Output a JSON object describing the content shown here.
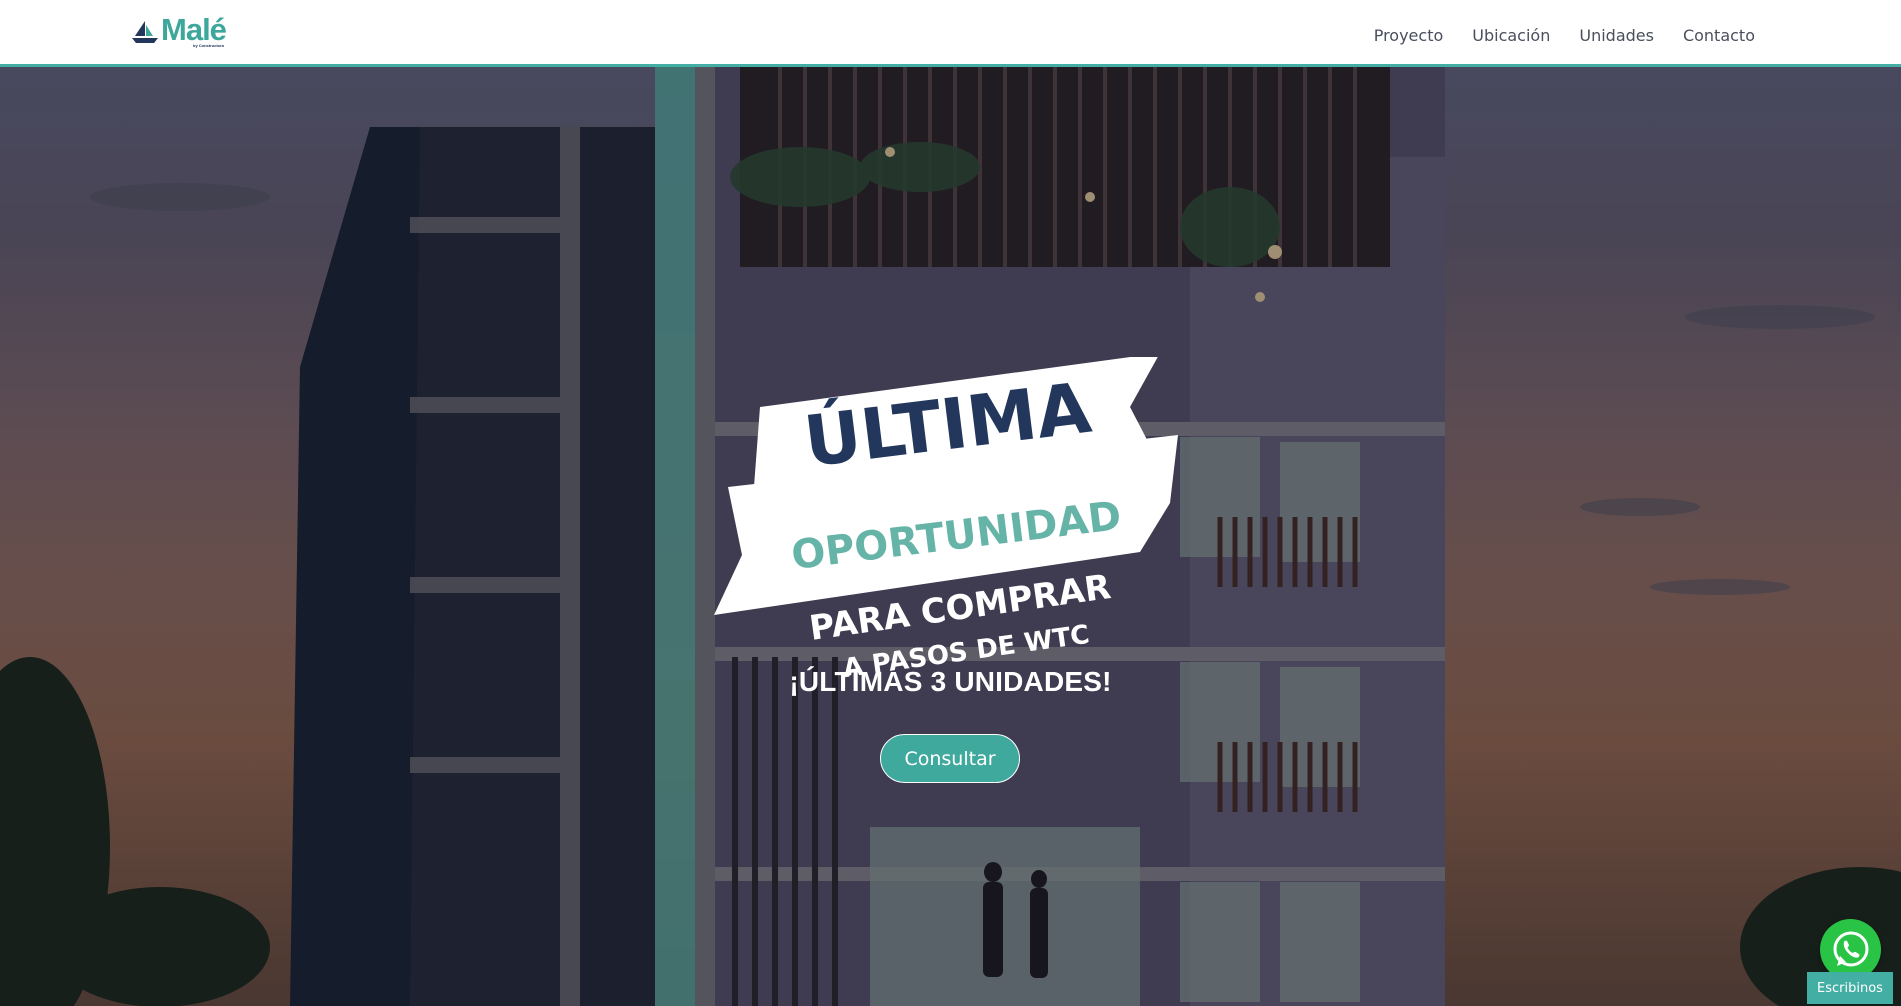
{
  "brand": {
    "name": "Malé",
    "byline": "by Constructora",
    "color": "#3da79b",
    "icon": "sailboat-icon"
  },
  "nav": {
    "items": [
      {
        "label": "Proyecto"
      },
      {
        "label": "Ubicación"
      },
      {
        "label": "Unidades"
      },
      {
        "label": "Contacto"
      }
    ]
  },
  "hero": {
    "banner_line1": "ÚLTIMA",
    "banner_line2": "OPORTUNIDAD",
    "banner_line3": "PARA COMPRAR",
    "banner_line4": "A PASOS DE WTC",
    "units_text": "¡ÚLTIMAS 3 UNIDADES!",
    "cta_label": "Consultar",
    "accent": "#43aea3",
    "navy": "#23375c"
  },
  "whatsapp": {
    "icon": "whatsapp-icon",
    "label": "Escribinos",
    "color": "#29c346"
  }
}
